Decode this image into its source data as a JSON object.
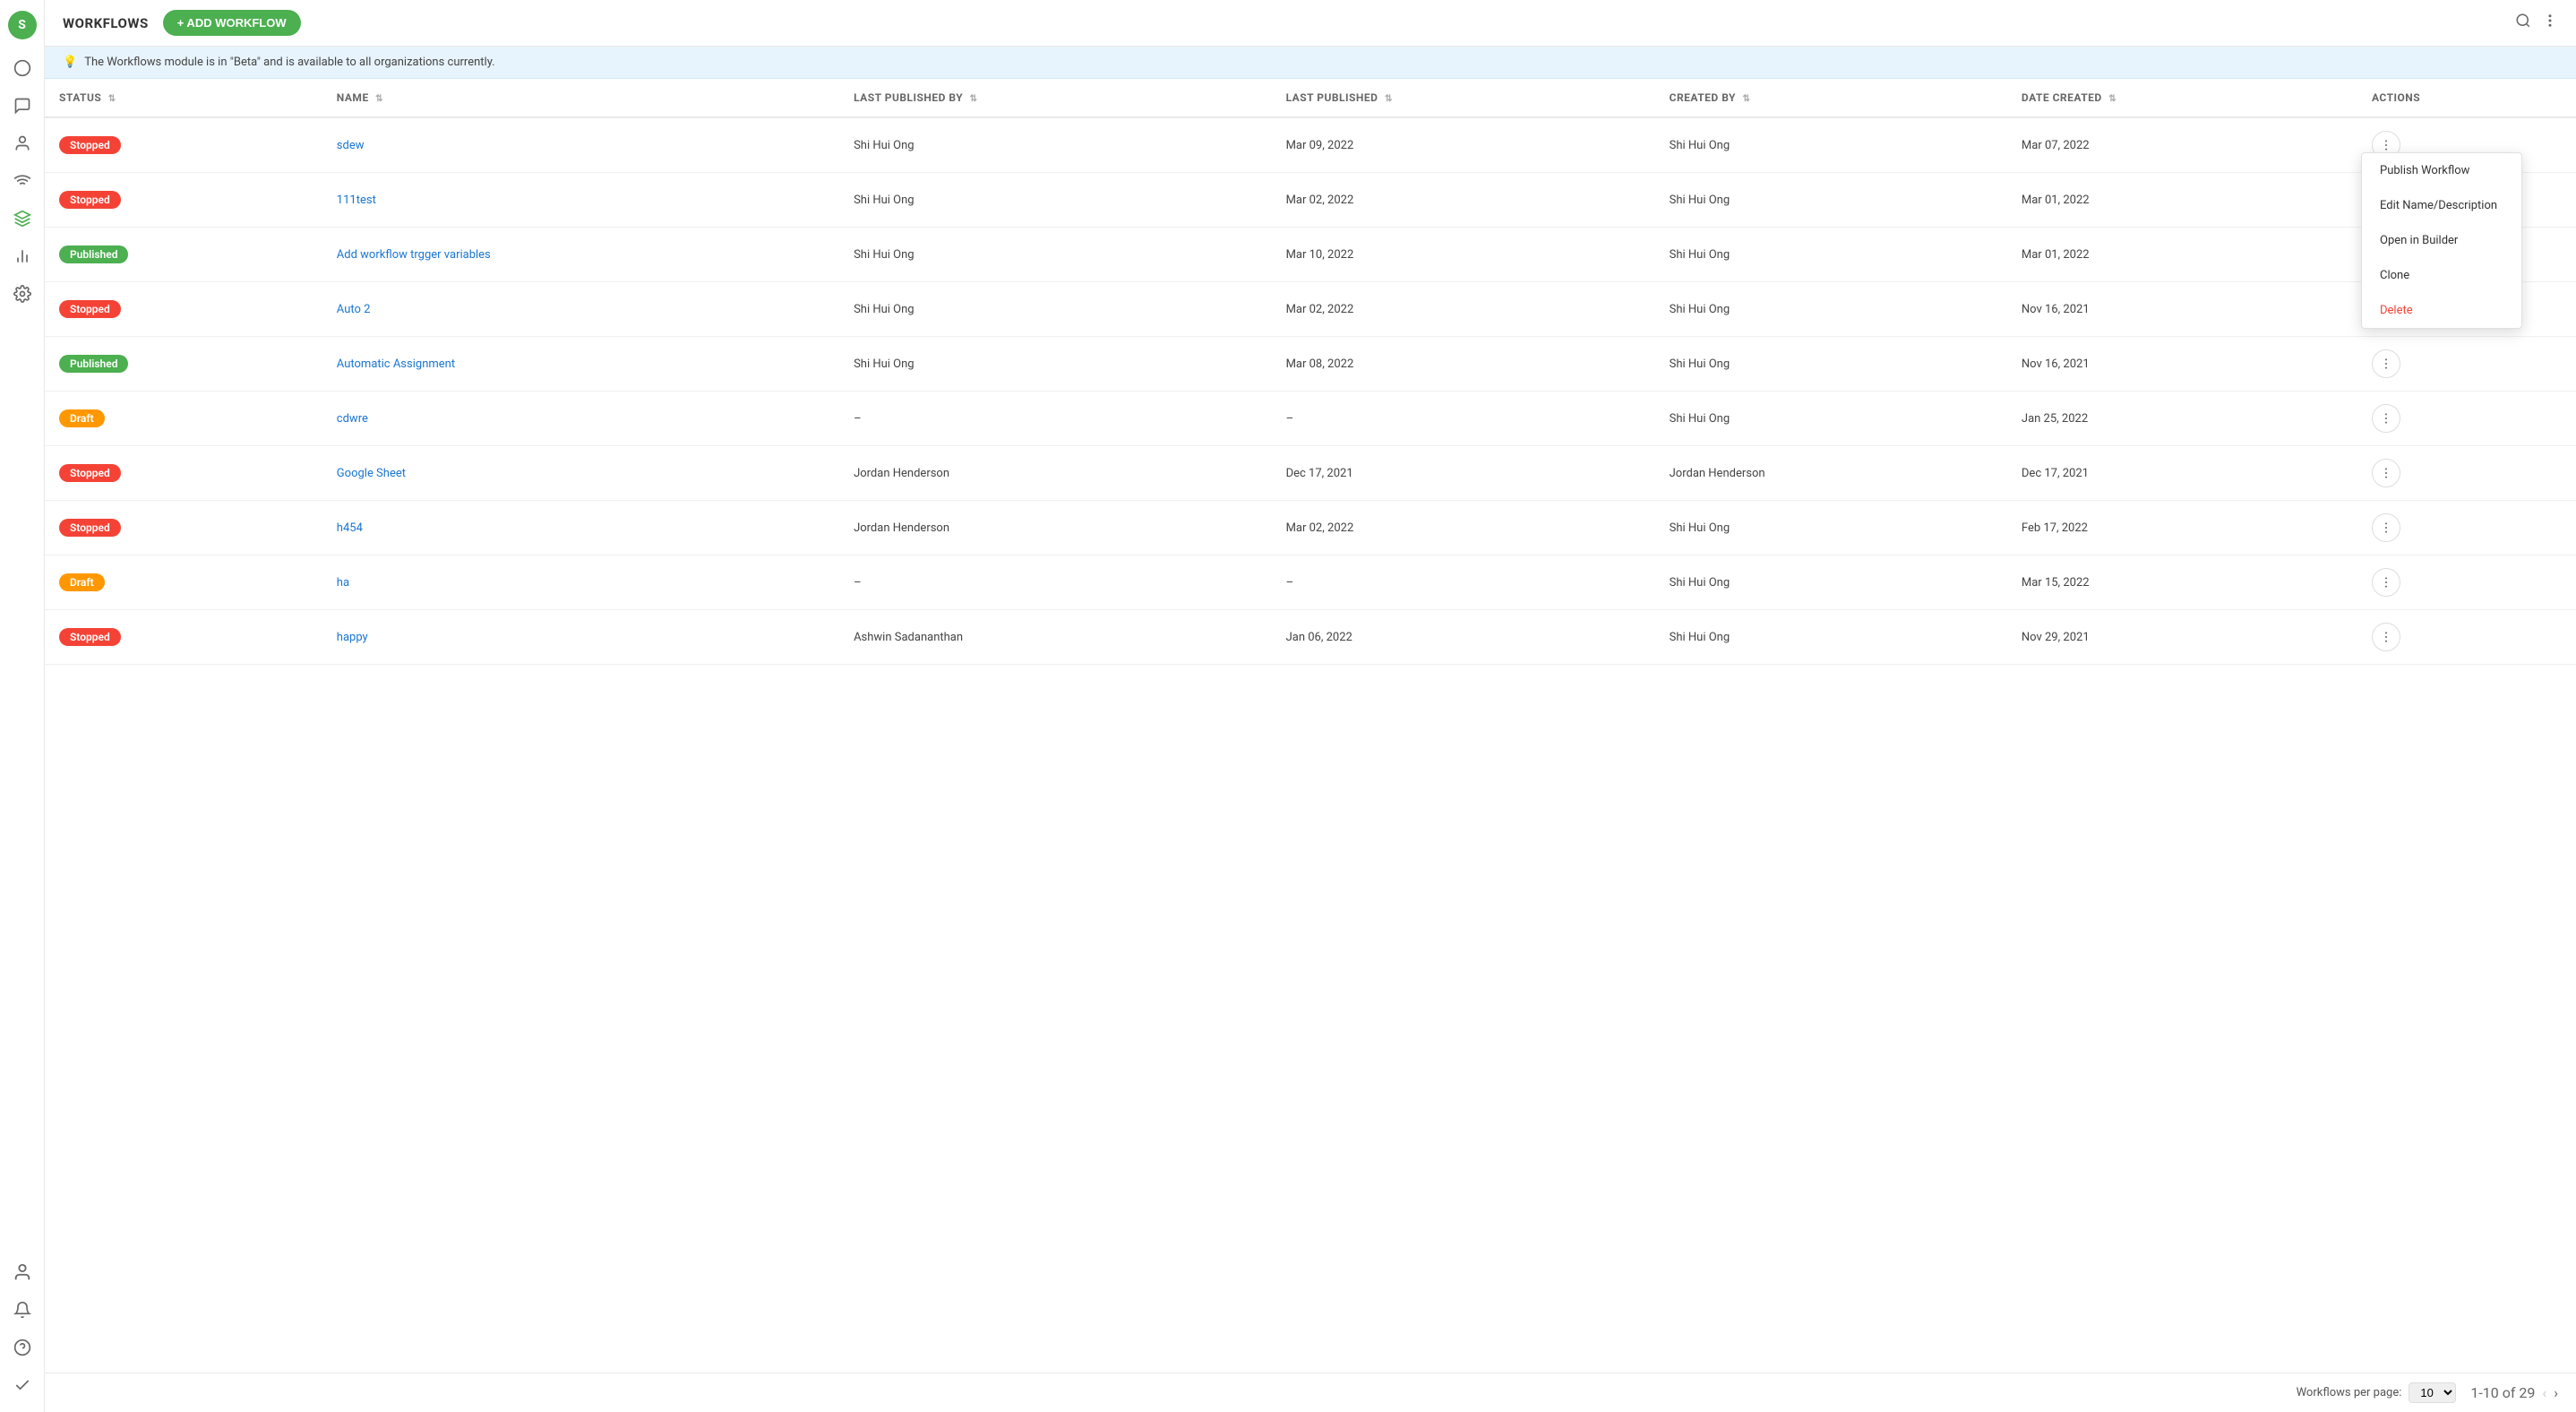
{
  "app": {
    "title": "WORKFLOWS",
    "add_button_label": "+ ADD WORKFLOW",
    "avatar_letter": "S"
  },
  "banner": {
    "text": "The Workflows module is in \"Beta\" and is available to all organizations currently.",
    "icon": "💡"
  },
  "table": {
    "columns": [
      {
        "key": "status",
        "label": "STATUS"
      },
      {
        "key": "name",
        "label": "NAME"
      },
      {
        "key": "last_published_by",
        "label": "LAST PUBLISHED BY"
      },
      {
        "key": "last_published",
        "label": "LAST PUBLISHED"
      },
      {
        "key": "created_by",
        "label": "CREATED BY"
      },
      {
        "key": "date_created",
        "label": "DATE CREATED"
      },
      {
        "key": "actions",
        "label": "ACTIONS"
      }
    ],
    "rows": [
      {
        "id": 1,
        "status": "Stopped",
        "status_type": "stopped",
        "name": "sdew",
        "last_published_by": "Shi Hui Ong",
        "last_published": "Mar 09, 2022",
        "created_by": "Shi Hui Ong",
        "date_created": "Mar 07, 2022"
      },
      {
        "id": 2,
        "status": "Stopped",
        "status_type": "stopped",
        "name": "111test",
        "last_published_by": "Shi Hui Ong",
        "last_published": "Mar 02, 2022",
        "created_by": "Shi Hui Ong",
        "date_created": "Mar 01, 2022"
      },
      {
        "id": 3,
        "status": "Published",
        "status_type": "published",
        "name": "Add workflow trgger variables",
        "last_published_by": "Shi Hui Ong",
        "last_published": "Mar 10, 2022",
        "created_by": "Shi Hui Ong",
        "date_created": "Mar 01, 2022"
      },
      {
        "id": 4,
        "status": "Stopped",
        "status_type": "stopped",
        "name": "Auto 2",
        "last_published_by": "Shi Hui Ong",
        "last_published": "Mar 02, 2022",
        "created_by": "Shi Hui Ong",
        "date_created": "Nov 16, 2021"
      },
      {
        "id": 5,
        "status": "Published",
        "status_type": "published",
        "name": "Automatic Assignment",
        "last_published_by": "Shi Hui Ong",
        "last_published": "Mar 08, 2022",
        "created_by": "Shi Hui Ong",
        "date_created": "Nov 16, 2021"
      },
      {
        "id": 6,
        "status": "Draft",
        "status_type": "draft",
        "name": "cdwre",
        "last_published_by": "–",
        "last_published": "–",
        "created_by": "Shi Hui Ong",
        "date_created": "Jan 25, 2022"
      },
      {
        "id": 7,
        "status": "Stopped",
        "status_type": "stopped",
        "name": "Google Sheet",
        "last_published_by": "Jordan Henderson",
        "last_published": "Dec 17, 2021",
        "created_by": "Jordan Henderson",
        "date_created": "Dec 17, 2021"
      },
      {
        "id": 8,
        "status": "Stopped",
        "status_type": "stopped",
        "name": "h454",
        "last_published_by": "Jordan Henderson",
        "last_published": "Mar 02, 2022",
        "created_by": "Shi Hui Ong",
        "date_created": "Feb 17, 2022"
      },
      {
        "id": 9,
        "status": "Draft",
        "status_type": "draft",
        "name": "ha",
        "last_published_by": "–",
        "last_published": "–",
        "created_by": "Shi Hui Ong",
        "date_created": "Mar 15, 2022"
      },
      {
        "id": 10,
        "status": "Stopped",
        "status_type": "stopped",
        "name": "happy",
        "last_published_by": "Ashwin Sadananthan",
        "last_published": "Jan 06, 2022",
        "created_by": "Shi Hui Ong",
        "date_created": "Nov 29, 2021"
      }
    ]
  },
  "context_menu": {
    "items": [
      {
        "label": "Publish Workflow",
        "type": "normal"
      },
      {
        "label": "Edit Name/Description",
        "type": "normal"
      },
      {
        "label": "Open in Builder",
        "type": "normal"
      },
      {
        "label": "Clone",
        "type": "normal"
      },
      {
        "label": "Delete",
        "type": "delete"
      }
    ]
  },
  "pagination": {
    "per_page_label": "Workflows per page:",
    "per_page_value": "10",
    "range": "1-10 of 29"
  },
  "sidebar": {
    "avatar_letter": "S",
    "items": [
      {
        "icon": "○",
        "name": "home",
        "label": "Home"
      },
      {
        "icon": "💬",
        "name": "chat",
        "label": "Chat"
      },
      {
        "icon": "👤",
        "name": "contacts",
        "label": "Contacts"
      },
      {
        "icon": "📡",
        "name": "broadcasts",
        "label": "Broadcasts"
      },
      {
        "icon": "⬡",
        "name": "workflows",
        "label": "Workflows",
        "active": true
      },
      {
        "icon": "📊",
        "name": "reports",
        "label": "Reports"
      },
      {
        "icon": "⚙",
        "name": "settings",
        "label": "Settings"
      }
    ],
    "bottom_items": [
      {
        "icon": "👤",
        "name": "profile",
        "label": "Profile"
      },
      {
        "icon": "🔔",
        "name": "notifications",
        "label": "Notifications"
      },
      {
        "icon": "?",
        "name": "help",
        "label": "Help"
      },
      {
        "icon": "✓",
        "name": "tasks",
        "label": "Tasks"
      }
    ]
  }
}
